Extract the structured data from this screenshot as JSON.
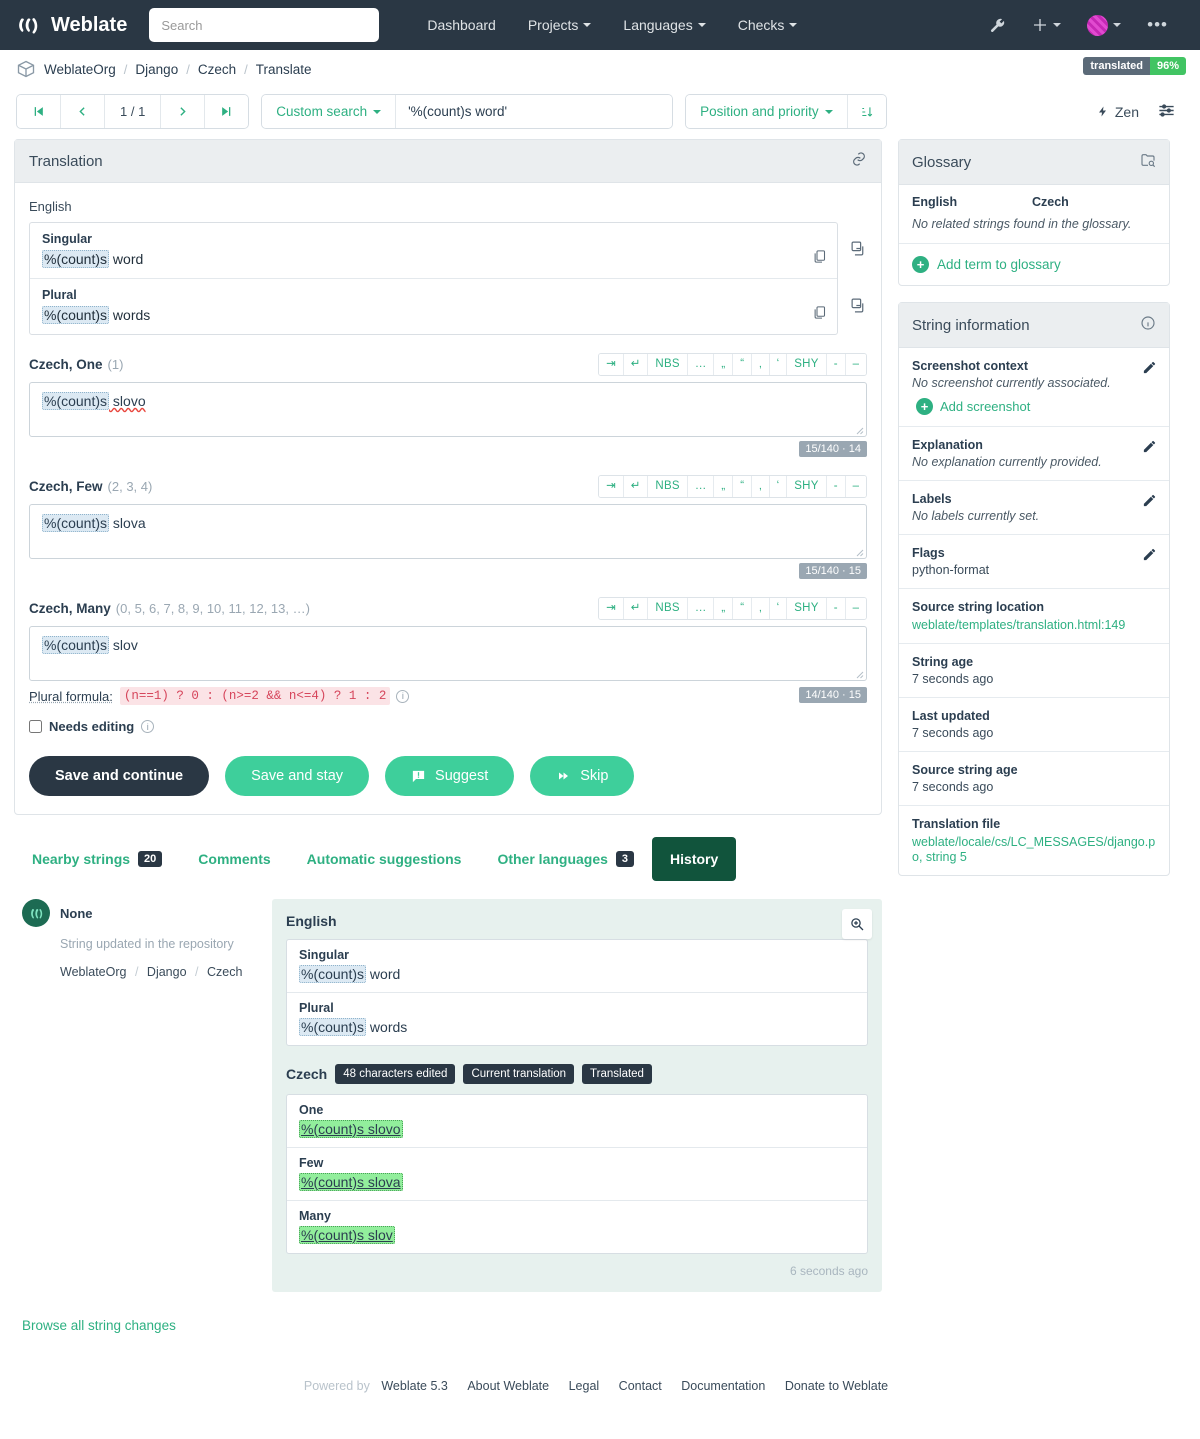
{
  "navbar": {
    "brand": "Weblate",
    "search_placeholder": "Search",
    "links": [
      {
        "label": "Dashboard",
        "caret": false
      },
      {
        "label": "Projects",
        "caret": true
      },
      {
        "label": "Languages",
        "caret": true
      },
      {
        "label": "Checks",
        "caret": true
      }
    ],
    "tools_icon": "wrench-icon",
    "add_icon": "plus-icon",
    "avatar_icon": "user-avatar",
    "more_icon": "ellipsis-icon"
  },
  "breadcrumb": {
    "items": [
      "WeblateOrg",
      "Django",
      "Czech",
      "Translate"
    ],
    "separator": "/",
    "badge_label": "translated",
    "badge_value": "96%"
  },
  "toolbar": {
    "first_label": "|<",
    "prev_label": "‹",
    "page": "1 / 1",
    "next_label": "›",
    "last_label": ">|",
    "search_mode": "Custom search",
    "search_query": "'%(count)s word'",
    "sort_mode": "Position and priority",
    "zen_label": "Zen",
    "settings_icon": "sliders-icon"
  },
  "translation": {
    "card_title": "Translation",
    "link_icon": "link-icon",
    "source_language": "English",
    "source_forms": [
      {
        "form": "Singular",
        "placeholder": "%(count)s",
        "rest": " word"
      },
      {
        "form": "Plural",
        "placeholder": "%(count)s",
        "rest": " words"
      }
    ],
    "chartools": [
      "⇥",
      "↵",
      "NBS",
      "…",
      "„",
      "“",
      "‚",
      "‘",
      "SHY",
      "-",
      "–"
    ],
    "targets": [
      {
        "title": "Czech, One",
        "plurals": "(1)",
        "placeholder": "%(count)s",
        "rest": " slovo",
        "spellcheck_word": "slovo",
        "counter": "15/140 · 14"
      },
      {
        "title": "Czech, Few",
        "plurals": "(2, 3, 4)",
        "placeholder": "%(count)s",
        "rest": " slova",
        "spellcheck_word": "",
        "counter": "15/140 · 15"
      },
      {
        "title": "Czech, Many",
        "plurals": "(0, 5, 6, 7, 8, 9, 10, 11, 12, 13, …)",
        "placeholder": "%(count)s",
        "rest": " slov",
        "spellcheck_word": "",
        "counter": "14/140 · 15"
      }
    ],
    "plural_formula_label": "Plural formula:",
    "plural_formula": "(n==1) ? 0 : (n>=2 && n<=4) ? 1 : 2",
    "needs_editing": "Needs editing",
    "buttons": {
      "save_continue": "Save and continue",
      "save_stay": "Save and stay",
      "suggest": "Suggest",
      "skip": "Skip"
    }
  },
  "tabs": [
    {
      "label": "Nearby strings",
      "badge": "20",
      "active": false
    },
    {
      "label": "Comments",
      "badge": "",
      "active": false
    },
    {
      "label": "Automatic suggestions",
      "badge": "",
      "active": false
    },
    {
      "label": "Other languages",
      "badge": "3",
      "active": false
    },
    {
      "label": "History",
      "badge": "",
      "active": true
    }
  ],
  "history": {
    "author": "None",
    "note": "String updated in the repository",
    "crumbs": [
      "WeblateOrg",
      "Django",
      "Czech"
    ],
    "zoom_icon": "magnifier-plus-icon",
    "english_label": "English",
    "english_forms": [
      {
        "form": "Singular",
        "placeholder": "%(count)s",
        "rest": " word"
      },
      {
        "form": "Plural",
        "placeholder": "%(count)s",
        "rest": " words"
      }
    ],
    "czech_label": "Czech",
    "czech_chips": [
      "48 characters edited",
      "Current translation",
      "Translated"
    ],
    "czech_forms": [
      {
        "form": "One",
        "text": "%(count)s slovo"
      },
      {
        "form": "Few",
        "text": "%(count)s slova"
      },
      {
        "form": "Many",
        "text": "%(count)s slov"
      }
    ],
    "timestamp": "6 seconds ago",
    "browse_link": "Browse all string changes"
  },
  "glossary": {
    "title": "Glossary",
    "search_icon": "glossary-search-icon",
    "col_english": "English",
    "col_czech": "Czech",
    "empty": "No related strings found in the glossary.",
    "add_label": "Add term to glossary"
  },
  "string_information": {
    "title": "String information",
    "info_icon": "info-icon",
    "rows": [
      {
        "title": "Screenshot context",
        "value": "No screenshot currently associated.",
        "style": "muted",
        "edit": true,
        "action": "Add screenshot"
      },
      {
        "title": "Explanation",
        "value": "No explanation currently provided.",
        "style": "muted",
        "edit": true,
        "action": ""
      },
      {
        "title": "Labels",
        "value": "No labels currently set.",
        "style": "muted",
        "edit": true,
        "action": ""
      },
      {
        "title": "Flags",
        "value": "python-format",
        "style": "plain",
        "edit": true,
        "action": ""
      },
      {
        "title": "Source string location",
        "value": "weblate/templates/translation.html:149",
        "style": "link",
        "edit": false,
        "action": ""
      },
      {
        "title": "String age",
        "value": "7 seconds ago",
        "style": "plain",
        "edit": false,
        "action": ""
      },
      {
        "title": "Last updated",
        "value": "7 seconds ago",
        "style": "plain",
        "edit": false,
        "action": ""
      },
      {
        "title": "Source string age",
        "value": "7 seconds ago",
        "style": "plain",
        "edit": false,
        "action": ""
      },
      {
        "title": "Translation file",
        "value": "weblate/locale/cs/LC_MESSAGES/django.po, string 5",
        "style": "link",
        "edit": false,
        "action": ""
      }
    ]
  },
  "footer": {
    "powered_by": "Powered by",
    "product": "Weblate 5.3",
    "links": [
      "About Weblate",
      "Legal",
      "Contact",
      "Documentation",
      "Donate to Weblate"
    ]
  }
}
